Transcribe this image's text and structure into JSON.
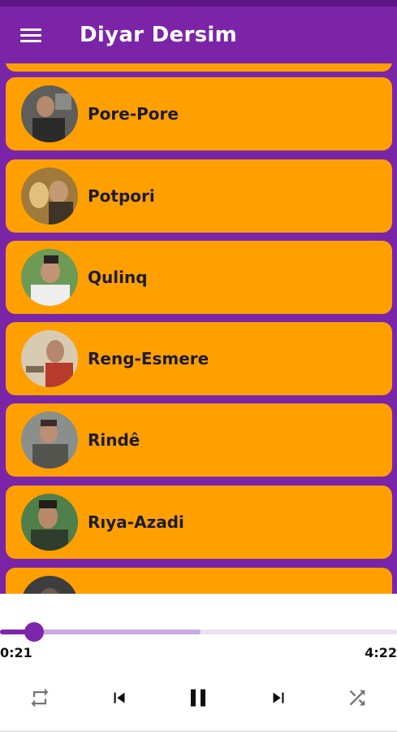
{
  "app": {
    "title": "Diyar Dersim",
    "accent": "#7b24a8",
    "card_color": "#ffa000"
  },
  "songs": [
    {
      "label": "Pore-Pore"
    },
    {
      "label": "Potpori"
    },
    {
      "label": "Qulinq"
    },
    {
      "label": "Reng-Esmere"
    },
    {
      "label": "Rindê"
    },
    {
      "label": "Rıya-Azadi"
    },
    {
      "label": ""
    }
  ],
  "player": {
    "current_time": "0:21",
    "duration": "4:22",
    "progress": 0.085,
    "buffered": 0.505,
    "state": "playing",
    "icons": [
      "repeat-icon",
      "previous-icon",
      "pause-icon",
      "next-icon",
      "shuffle-icon"
    ]
  }
}
